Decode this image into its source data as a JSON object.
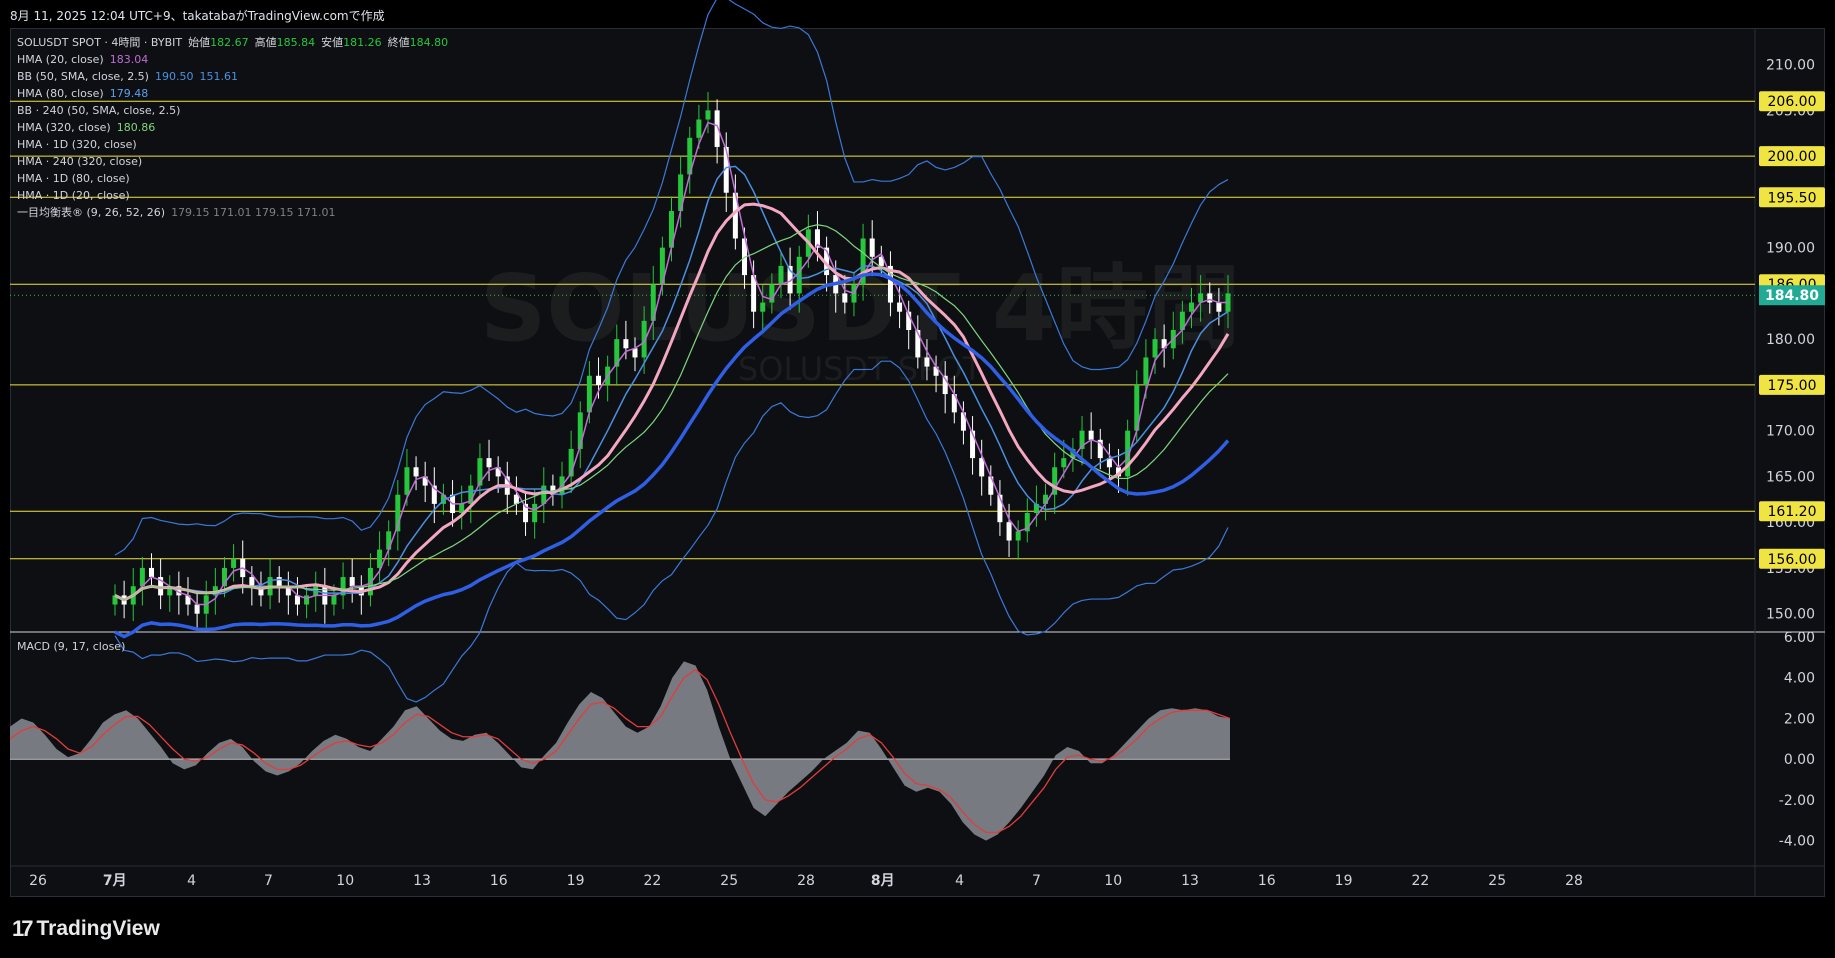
{
  "header": {
    "text": "8月 11, 2025 12:04 UTC+9、takatabaがTradingView.comで作成"
  },
  "legend": {
    "symbol_line": {
      "symbol": "SOLUSDT SPOT · 4時間 · BYBIT",
      "open_label": "始値",
      "open": "182.67",
      "high_label": "高値",
      "high": "185.84",
      "low_label": "安値",
      "low": "181.26",
      "close_label": "終値",
      "close": "184.80"
    },
    "indicators": [
      {
        "label": "HMA (20, close)",
        "value": "183.04",
        "color": "#c06cd6"
      },
      {
        "label": "BB (50, SMA, close, 2.5)",
        "value": "190.50",
        "value2": "151.61",
        "color": "#4a90e2"
      },
      {
        "label": "HMA (80, close)",
        "value": "179.48",
        "color": "#5aa0f0"
      },
      {
        "label": "BB · 240 (50, SMA, close, 2.5)",
        "value": "",
        "color": "#d1d4dc"
      },
      {
        "label": "HMA (320, close)",
        "value": "180.86",
        "color": "#7fd67f"
      },
      {
        "label": "HMA · 1D (320, close)",
        "value": "",
        "color": "#d1d4dc"
      },
      {
        "label": "HMA · 240 (320, close)",
        "value": "",
        "color": "#d1d4dc"
      },
      {
        "label": "HMA · 1D (80, close)",
        "value": "",
        "color": "#d1d4dc"
      },
      {
        "label": "HMA · 1D (20, close)",
        "value": "",
        "color": "#d1d4dc"
      },
      {
        "label": "一目均衡表® (9, 26, 52, 26)",
        "value": "179.15  171.01  179.15  171.01",
        "color": "#808080"
      }
    ]
  },
  "watermark": {
    "big": "SOLUSDT 4時間",
    "small": "SOLUSDT SPOT"
  },
  "macd_label": "MACD (9, 17, close)",
  "footer": {
    "brand": "TradingView",
    "logo_glyph": "17"
  },
  "colors": {
    "up": "#26c63d",
    "down": "#ffffff",
    "hline": "#f0e442",
    "bb_upper": "#3a78d8",
    "hma320": "#2f5fe6",
    "hma_pink": "#f4a7c0",
    "hma_purple": "#c06cd6",
    "hma_light_blue": "#4a90e2",
    "hma_green": "#7fd67f"
  },
  "chart_data": [
    {
      "type": "candlestick",
      "title": "SOLUSDT SPOT · 4時間 · BYBIT",
      "ylim": [
        148,
        214
      ],
      "y_ticks": [
        150.0,
        155.0,
        160.0,
        165.0,
        170.0,
        175.0,
        180.0,
        185.0,
        190.0,
        195.0,
        200.0,
        205.0,
        210.0
      ],
      "x_ticks": [
        "26",
        "7月",
        "4",
        "7",
        "10",
        "13",
        "16",
        "19",
        "22",
        "25",
        "28",
        "8月",
        "4",
        "7",
        "10",
        "13",
        "16",
        "19",
        "22",
        "25",
        "28"
      ],
      "horizontal_levels": [
        206.0,
        200.0,
        195.5,
        186.0,
        175.0,
        161.2,
        156.0
      ],
      "last_price": 184.8,
      "close_series": [
        152,
        151,
        153,
        155,
        154,
        152,
        153,
        152,
        151,
        150,
        152,
        153,
        155,
        156,
        154,
        153,
        152,
        154,
        153,
        152,
        151,
        152,
        153,
        151,
        152,
        154,
        153,
        152,
        155,
        157,
        159,
        163,
        166,
        165,
        164,
        162,
        163,
        161,
        162,
        164,
        167,
        166,
        165,
        163,
        162,
        160,
        162,
        164,
        163,
        165,
        168,
        172,
        176,
        175,
        177,
        180,
        179,
        178,
        182,
        186,
        190,
        194,
        198,
        202,
        204,
        205,
        201,
        196,
        191,
        187,
        183,
        184,
        186,
        188,
        185,
        189,
        192,
        190,
        187,
        185,
        184,
        186,
        191,
        189,
        188,
        184,
        183,
        181,
        178,
        177,
        176,
        174,
        172,
        170,
        167,
        165,
        163,
        160,
        158,
        159,
        161,
        162,
        163,
        166,
        167,
        168,
        170,
        169,
        167,
        166,
        165,
        170,
        175,
        178,
        180,
        179,
        181,
        183,
        184,
        185,
        184,
        183,
        185
      ]
    },
    {
      "type": "macd",
      "title": "MACD (9, 17, close)",
      "ylim": [
        -5,
        6
      ],
      "y_ticks": [
        6.0,
        4.0,
        2.0,
        0.0,
        -2.0,
        -4.0
      ],
      "histogram": [
        1.6,
        2.0,
        1.8,
        1.2,
        0.5,
        0.1,
        0.3,
        1.0,
        1.8,
        2.2,
        2.4,
        2.0,
        1.3,
        0.6,
        -0.2,
        -0.5,
        -0.3,
        0.3,
        0.8,
        1.0,
        0.6,
        -0.1,
        -0.6,
        -0.8,
        -0.6,
        -0.2,
        0.4,
        0.9,
        1.2,
        1.0,
        0.6,
        0.4,
        1.0,
        1.6,
        2.4,
        2.6,
        2.0,
        1.4,
        1.0,
        0.9,
        1.2,
        1.3,
        0.8,
        0.2,
        -0.4,
        -0.5,
        0.2,
        0.8,
        1.8,
        2.7,
        3.3,
        3.0,
        2.3,
        1.6,
        1.3,
        1.6,
        2.6,
        4.0,
        4.8,
        4.6,
        3.4,
        1.6,
        0.0,
        -1.2,
        -2.4,
        -2.8,
        -2.2,
        -1.6,
        -1.1,
        -0.6,
        0.0,
        0.4,
        0.8,
        1.4,
        1.3,
        0.5,
        -0.4,
        -1.3,
        -1.6,
        -1.4,
        -1.6,
        -2.2,
        -3.1,
        -3.7,
        -4.0,
        -3.7,
        -3.1,
        -2.4,
        -1.6,
        -0.8,
        0.2,
        0.6,
        0.4,
        -0.2,
        -0.2,
        0.2,
        0.8,
        1.4,
        2.0,
        2.4,
        2.5,
        2.4,
        2.5,
        2.4,
        2.1,
        2.0
      ],
      "signal": [
        1.0,
        1.4,
        1.6,
        1.4,
        1.0,
        0.5,
        0.3,
        0.6,
        1.2,
        1.7,
        2.1,
        2.1,
        1.7,
        1.1,
        0.5,
        0.0,
        -0.1,
        0.1,
        0.5,
        0.8,
        0.7,
        0.3,
        -0.2,
        -0.5,
        -0.5,
        -0.3,
        0.1,
        0.5,
        0.8,
        0.9,
        0.7,
        0.6,
        0.8,
        1.2,
        1.8,
        2.2,
        2.1,
        1.7,
        1.3,
        1.1,
        1.1,
        1.2,
        1.0,
        0.5,
        0.0,
        -0.2,
        0.0,
        0.4,
        1.2,
        2.0,
        2.7,
        2.8,
        2.5,
        2.0,
        1.6,
        1.6,
        2.1,
        3.1,
        4.0,
        4.4,
        3.9,
        2.7,
        1.3,
        0.0,
        -1.2,
        -2.0,
        -2.1,
        -1.8,
        -1.4,
        -0.9,
        -0.4,
        0.1,
        0.5,
        1.0,
        1.2,
        0.8,
        0.1,
        -0.7,
        -1.2,
        -1.3,
        -1.5,
        -1.9,
        -2.6,
        -3.2,
        -3.6,
        -3.6,
        -3.3,
        -2.8,
        -2.1,
        -1.4,
        -0.5,
        0.1,
        0.2,
        0.0,
        -0.1,
        0.1,
        0.5,
        1.0,
        1.6,
        2.0,
        2.3,
        2.4,
        2.4,
        2.4,
        2.2,
        2.0
      ]
    }
  ]
}
